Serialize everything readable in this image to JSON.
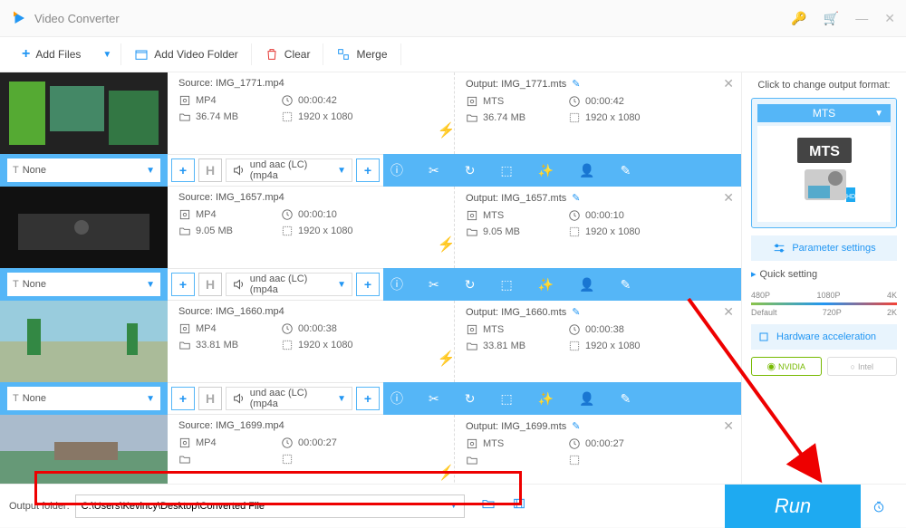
{
  "app": {
    "title": "Video Converter"
  },
  "toolbar": {
    "add_files": "Add Files",
    "add_folder": "Add Video Folder",
    "clear": "Clear",
    "merge": "Merge"
  },
  "files": [
    {
      "source": "Source: IMG_1771.mp4",
      "output": "Output: IMG_1771.mts",
      "src_format": "MP4",
      "src_duration": "00:00:42",
      "src_size": "36.74 MB",
      "src_res": "1920 x 1080",
      "out_format": "MTS",
      "out_duration": "00:00:42",
      "out_size": "36.74 MB",
      "out_res": "1920 x 1080",
      "subtitle": "None",
      "audio": "und aac (LC) (mp4a"
    },
    {
      "source": "Source: IMG_1657.mp4",
      "output": "Output: IMG_1657.mts",
      "src_format": "MP4",
      "src_duration": "00:00:10",
      "src_size": "9.05 MB",
      "src_res": "1920 x 1080",
      "out_format": "MTS",
      "out_duration": "00:00:10",
      "out_size": "9.05 MB",
      "out_res": "1920 x 1080",
      "subtitle": "None",
      "audio": "und aac (LC) (mp4a"
    },
    {
      "source": "Source: IMG_1660.mp4",
      "output": "Output: IMG_1660.mts",
      "src_format": "MP4",
      "src_duration": "00:00:38",
      "src_size": "33.81 MB",
      "src_res": "1920 x 1080",
      "out_format": "MTS",
      "out_duration": "00:00:38",
      "out_size": "33.81 MB",
      "out_res": "1920 x 1080",
      "subtitle": "None",
      "audio": "und aac (LC) (mp4a"
    },
    {
      "source": "Source: IMG_1699.mp4",
      "output": "Output: IMG_1699.mts",
      "src_format": "MP4",
      "src_duration": "00:00:27",
      "src_size": "",
      "src_res": "",
      "out_format": "MTS",
      "out_duration": "00:00:27",
      "out_size": "",
      "out_res": "",
      "subtitle": "None",
      "audio": ""
    }
  ],
  "sidebar": {
    "title": "Click to change output format:",
    "format": "MTS",
    "param": "Parameter settings",
    "quick": "Quick setting",
    "labels_top": [
      "480P",
      "1080P",
      "4K"
    ],
    "labels_bot": [
      "Default",
      "720P",
      "2K"
    ],
    "hw": "Hardware acceleration",
    "nvidia": "NVIDIA",
    "intel": "Intel"
  },
  "bottom": {
    "label": "Output folder:",
    "path": "C:\\Users\\Kevincy\\Desktop\\Converted File",
    "run": "Run"
  }
}
